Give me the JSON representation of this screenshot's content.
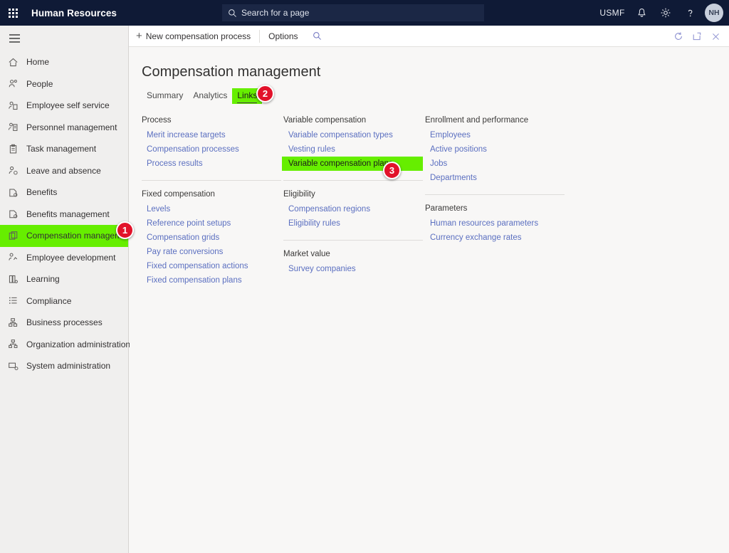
{
  "header": {
    "waffle_icon": "app-launcher-icon",
    "app_title": "Human Resources",
    "search": {
      "icon": "search-icon",
      "placeholder": "Search for a page",
      "value": ""
    },
    "company": "USMF",
    "notifications_icon": "bell-icon",
    "settings_icon": "gear-icon",
    "help_icon": "question-mark-icon",
    "avatar_initials": "NH"
  },
  "sidebar": {
    "menu_icon": "hamburger-icon",
    "items": [
      {
        "label": "Home",
        "icon": "home-icon",
        "active": false
      },
      {
        "label": "People",
        "icon": "people-icon",
        "active": false
      },
      {
        "label": "Employee self service",
        "icon": "person-page-icon",
        "active": false
      },
      {
        "label": "Personnel management",
        "icon": "person-badge-icon",
        "active": false
      },
      {
        "label": "Task management",
        "icon": "clipboard-icon",
        "active": false
      },
      {
        "label": "Leave and absence",
        "icon": "person-clock-icon",
        "active": false
      },
      {
        "label": "Benefits",
        "icon": "benefits-icon",
        "active": false
      },
      {
        "label": "Benefits management",
        "icon": "benefits-manage-icon",
        "active": false
      },
      {
        "label": "Compensation management",
        "icon": "compensation-icon",
        "active": true
      },
      {
        "label": "Employee development",
        "icon": "person-growth-icon",
        "active": false
      },
      {
        "label": "Learning",
        "icon": "learning-icon",
        "active": false
      },
      {
        "label": "Compliance",
        "icon": "list-icon",
        "active": false
      },
      {
        "label": "Business processes",
        "icon": "process-icon",
        "active": false
      },
      {
        "label": "Organization administration",
        "icon": "org-chart-icon",
        "active": false
      },
      {
        "label": "System administration",
        "icon": "system-icon",
        "active": false
      }
    ]
  },
  "toolbar": {
    "new_label": "New compensation process",
    "new_icon": "plus-icon",
    "options_label": "Options",
    "search_icon": "search-icon",
    "refresh_icon": "refresh-icon",
    "popout_icon": "open-in-new-window-icon",
    "close_icon": "close-icon"
  },
  "main": {
    "page_title": "Compensation management",
    "tabs": [
      {
        "label": "Summary",
        "selected": false
      },
      {
        "label": "Analytics",
        "selected": false
      },
      {
        "label": "Links",
        "selected": true
      }
    ],
    "columns": [
      {
        "groups": [
          {
            "heading": "Process",
            "links": [
              {
                "label": "Merit increase targets",
                "highlighted": false
              },
              {
                "label": "Compensation processes",
                "highlighted": false
              },
              {
                "label": "Process results",
                "highlighted": false
              }
            ]
          },
          {
            "heading": "Fixed compensation",
            "links": [
              {
                "label": "Levels",
                "highlighted": false
              },
              {
                "label": "Reference point setups",
                "highlighted": false
              },
              {
                "label": "Compensation grids",
                "highlighted": false
              },
              {
                "label": "Pay rate conversions",
                "highlighted": false
              },
              {
                "label": "Fixed compensation actions",
                "highlighted": false
              },
              {
                "label": "Fixed compensation plans",
                "highlighted": false
              }
            ]
          }
        ]
      },
      {
        "groups": [
          {
            "heading": "Variable compensation",
            "links": [
              {
                "label": "Variable compensation types",
                "highlighted": false
              },
              {
                "label": "Vesting rules",
                "highlighted": false
              },
              {
                "label": "Variable compensation plans",
                "highlighted": true
              }
            ]
          },
          {
            "heading": "Eligibility",
            "links": [
              {
                "label": "Compensation regions",
                "highlighted": false
              },
              {
                "label": "Eligibility rules",
                "highlighted": false
              }
            ]
          },
          {
            "heading": "Market value",
            "links": [
              {
                "label": "Survey companies",
                "highlighted": false
              }
            ]
          }
        ]
      },
      {
        "groups": [
          {
            "heading": "Enrollment and performance",
            "links": [
              {
                "label": "Employees",
                "highlighted": false
              },
              {
                "label": "Active positions",
                "highlighted": false
              },
              {
                "label": "Jobs",
                "highlighted": false
              },
              {
                "label": "Departments",
                "highlighted": false
              }
            ]
          },
          {
            "heading": "Parameters",
            "links": [
              {
                "label": "Human resources parameters",
                "highlighted": false
              },
              {
                "label": "Currency exchange rates",
                "highlighted": false
              }
            ]
          }
        ]
      }
    ]
  },
  "annotations": {
    "step1": "1",
    "step2": "2",
    "step3": "3"
  },
  "colors": {
    "header_bg": "#0f1a36",
    "highlight_green": "#66ee00",
    "badge_red": "#e2122a",
    "link_blue": "#5b6fc0"
  }
}
